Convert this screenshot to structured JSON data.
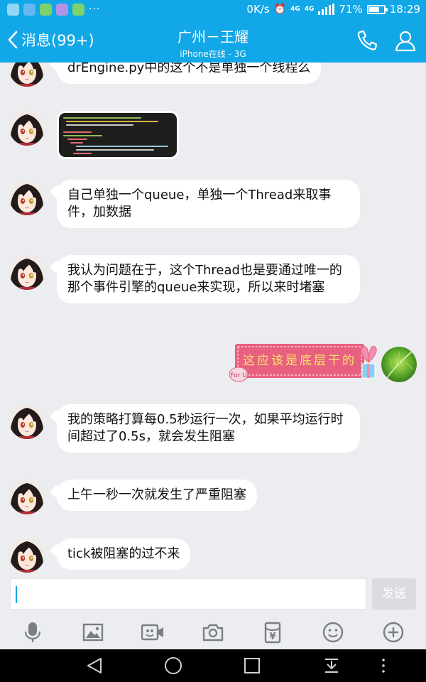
{
  "status_bar": {
    "notification_icons": [
      "app-icon",
      "heart-app-icon",
      "message-app-icon",
      "gallery-app-icon",
      "wechat-icon"
    ],
    "more": "···",
    "net_speed": "0K/s",
    "network_type": "4G",
    "battery": "71%",
    "battery_level": 0.71,
    "time": "18:29"
  },
  "header": {
    "back_label": "消息(99+)",
    "title": "广州－王耀",
    "subtitle": "iPhone在线 - 3G"
  },
  "messages": [
    {
      "side": "left",
      "type": "text",
      "text": "drEngine.py中的这个不是单独一个线程么"
    },
    {
      "side": "left",
      "type": "image",
      "text": ""
    },
    {
      "side": "left",
      "type": "text",
      "text": "自己单独一个queue，单独一个Thread来取事件，加数据"
    },
    {
      "side": "left",
      "type": "text",
      "text": "我认为问题在于，这个Thread也是要通过唯一的那个事件引擎的queue来实现，所以来时堵塞"
    },
    {
      "side": "right",
      "type": "sticker",
      "text": "这应该是底层干的"
    },
    {
      "side": "left",
      "type": "text",
      "text": "我的策略打算每0.5秒运行一次，如果平均运行时间超过了0.5s，就会发生阻塞"
    },
    {
      "side": "left",
      "type": "text",
      "text": "上午一秒一次就发生了严重阻塞"
    },
    {
      "side": "left",
      "type": "text",
      "text": "tick被阻塞的过不来"
    }
  ],
  "input": {
    "placeholder": "",
    "value": "",
    "send_label": "发送"
  },
  "toolbar": [
    "microphone-icon",
    "picture-icon",
    "video-icon",
    "camera-icon",
    "red-packet-icon",
    "emoji-icon",
    "plus-icon"
  ],
  "colors": {
    "accent": "#12a7e6",
    "chat_background": "#ebedf0",
    "bubble": "#ffffff",
    "sticker_pink": "#e8607f"
  }
}
